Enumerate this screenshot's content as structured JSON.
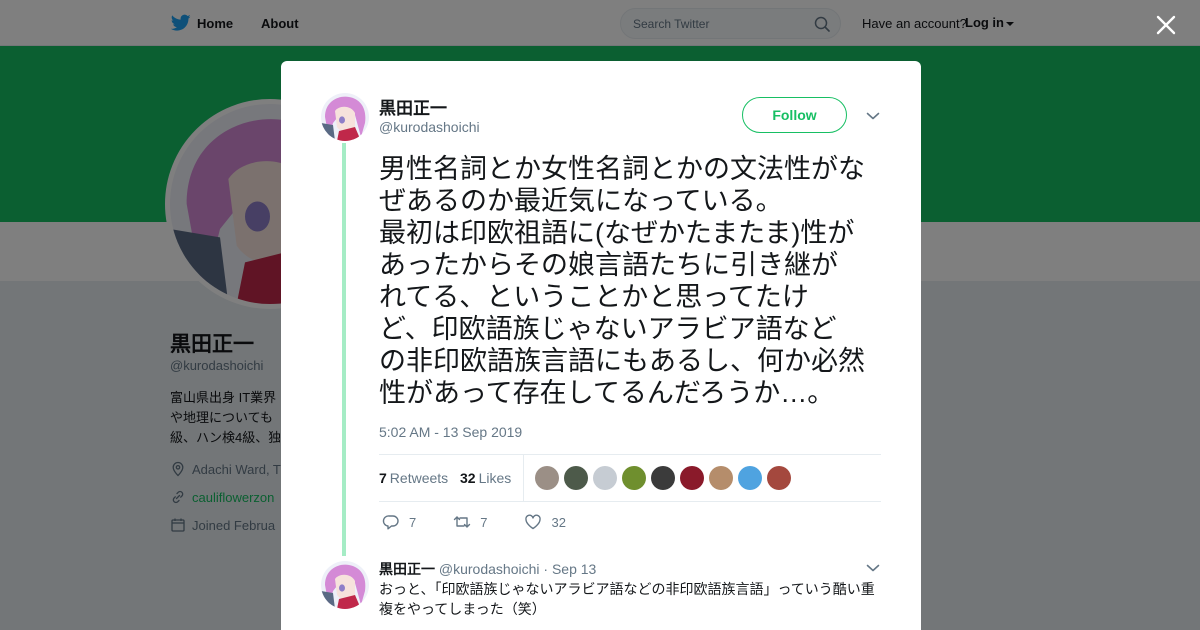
{
  "topbar": {
    "home_label": "Home",
    "about_label": "About",
    "search_placeholder": "Search Twitter",
    "have_account": "Have an account?",
    "login_label": "Log in"
  },
  "profile": {
    "name": "黒田正一",
    "handle": "@kurodashoichi",
    "bio_lines": [
      "富山県出身 IT業界",
      "や地理についても",
      "級、ハン検4級、独"
    ],
    "location": "Adachi Ward, T",
    "website": "cauliflowerzon",
    "joined": "Joined Februa"
  },
  "tweet": {
    "author_name": "黒田正一",
    "author_handle": "@kurodashoichi",
    "follow_label": "Follow",
    "text_lines": [
      "男性名詞とか女性名詞とかの文法性がな",
      "ぜあるのか最近気になっている。",
      "最初は印欧祖語に(なぜかたまたま)性が",
      "あったからその娘言語たちに引き継が",
      "れてる、ということかと思ってたけ",
      "ど、印欧語族じゃないアラビア語など",
      "の非印欧語族言語にもあるし、何か必然",
      "性があって存在してるんだろうか…。"
    ],
    "timestamp": "5:02 AM - 13 Sep 2019",
    "retweets_count": "7",
    "retweets_label": "Retweets",
    "likes_count": "32",
    "likes_label": "Likes",
    "reply_count": "7",
    "retweet_action_count": "7",
    "like_action_count": "32",
    "liker_colors": [
      "#9b8f86",
      "#4d5a4a",
      "#c6ccd3",
      "#6f8f2e",
      "#3b3b3b",
      "#8a1a2a",
      "#b58d6b",
      "#4fa3e0",
      "#a4483e"
    ]
  },
  "reply": {
    "author_name": "黒田正一",
    "author_handle": "@kurodashoichi",
    "date": "· Sep 13",
    "text": "おっと、「印欧語族じゃないアラビア語などの非印欧語族言語」っていう酷い重複をやってしまった（笑）"
  },
  "colors": {
    "accent": "#17bf63",
    "thread_line": "#a5ecc5",
    "secondary_text": "#657786"
  }
}
